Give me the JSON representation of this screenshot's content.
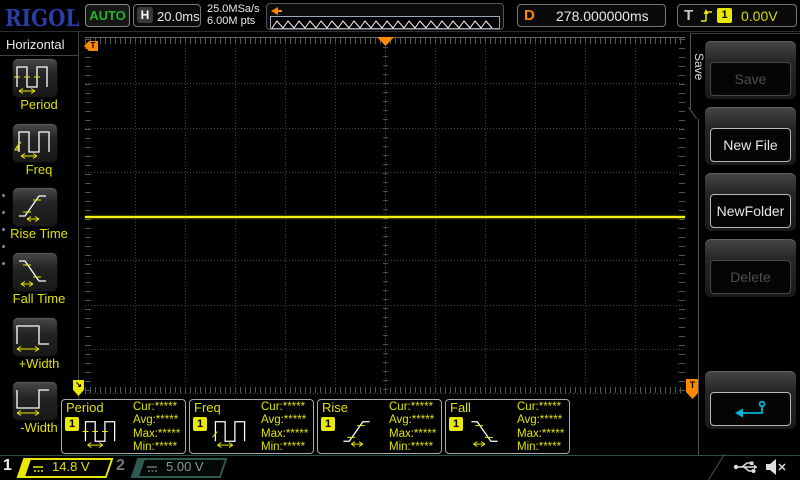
{
  "top_bar": {
    "logo": "RIGOL",
    "auto_label": "AUTO",
    "h_label": "H",
    "h_value": "20.0ms",
    "sample_rate": "25.0MSa/s",
    "memory_depth": "6.00M pts",
    "delay_label": "D",
    "delay_value": "278.000000ms",
    "trigger_label": "T",
    "trigger_channel": "1",
    "trigger_value": "0.00V"
  },
  "left_sidebar": {
    "title": "Horizontal",
    "items": [
      {
        "label": "Period",
        "icon": "period-icon"
      },
      {
        "label": "Freq",
        "icon": "freq-icon"
      },
      {
        "label": "Rise Time",
        "icon": "rise-time-icon"
      },
      {
        "label": "Fall Time",
        "icon": "fall-time-icon"
      },
      {
        "label": "+Width",
        "icon": "plus-width-icon"
      },
      {
        "label": "-Width",
        "icon": "minus-width-icon"
      }
    ]
  },
  "right_menu": {
    "tab_label": "Save",
    "buttons": [
      {
        "label": "Save",
        "enabled": false
      },
      {
        "label": "New File",
        "enabled": true
      },
      {
        "label": "NewFolder",
        "enabled": true
      },
      {
        "label": "Delete",
        "enabled": false
      }
    ],
    "back_icon": "return-arrow-icon"
  },
  "display": {
    "trace_color": "#f0f000",
    "trigger_marker_label": "T",
    "trigger_level_label": "T"
  },
  "measurements": [
    {
      "name": "Period",
      "channel": "1",
      "stats": [
        "Cur:*****",
        "Avg:*****",
        "Max:*****",
        "Min:*****"
      ]
    },
    {
      "name": "Freq",
      "channel": "1",
      "stats": [
        "Cur:*****",
        "Avg:*****",
        "Max:*****",
        "Min:*****"
      ]
    },
    {
      "name": "Rise",
      "channel": "1",
      "stats": [
        "Cur:*****",
        "Avg:*****",
        "Max:*****",
        "Min:*****"
      ]
    },
    {
      "name": "Fall",
      "channel": "1",
      "stats": [
        "Cur:*****",
        "Avg:*****",
        "Max:*****",
        "Min:*****"
      ]
    }
  ],
  "status_bar": {
    "channels": [
      {
        "num": "1",
        "value": "14.8 V",
        "active": true,
        "color": "#e8e800"
      },
      {
        "num": "2",
        "value": "5.00 V",
        "active": false,
        "color": "#2e5a52"
      }
    ]
  }
}
